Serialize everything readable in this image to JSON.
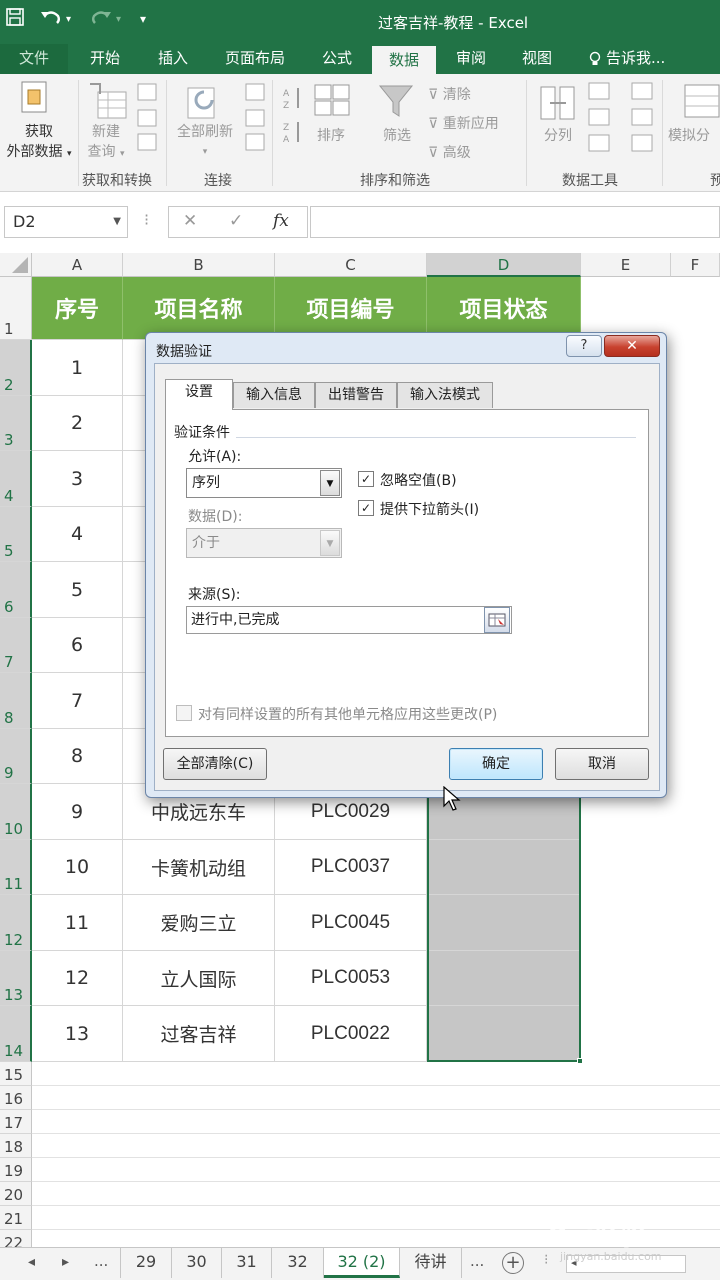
{
  "window": {
    "title": "过客吉祥-教程 - Excel",
    "quick_access": {
      "save_icon": "save-icon",
      "undo_icon": "undo-icon",
      "redo_icon": "redo-icon",
      "customize_icon": "customize-icon"
    }
  },
  "ribbon_tabs": {
    "file": "文件",
    "home": "开始",
    "insert": "插入",
    "page_layout": "页面布局",
    "formulas": "公式",
    "data": "数据",
    "review": "审阅",
    "view": "视图",
    "tell_me": "告诉我..."
  },
  "ribbon": {
    "get_external_data_1": "获取",
    "get_external_data_2": "外部数据",
    "new_query_1": "新建",
    "new_query_2": "查询",
    "group_get_transform": "获取和转换",
    "refresh_all": "全部刷新",
    "group_connections": "连接",
    "sort": "排序",
    "filter": "筛选",
    "clear": "清除",
    "reapply": "重新应用",
    "advanced": "高级",
    "group_sort_filter": "排序和筛选",
    "text_to_columns": "分列",
    "group_data_tools": "数据工具",
    "what_if": "模拟分",
    "group_forecast": "预"
  },
  "formula_bar": {
    "name_box": "D2",
    "cancel_symbol": "✕",
    "enter_symbol": "✓",
    "fx_symbol": "fx",
    "formula": ""
  },
  "grid": {
    "columns": [
      "A",
      "B",
      "C",
      "D",
      "E",
      "F"
    ],
    "header_row": [
      "序号",
      "项目名称",
      "项目编号",
      "项目状态"
    ],
    "rows": [
      {
        "row": "2",
        "a": "1",
        "b": "",
        "c": ""
      },
      {
        "row": "3",
        "a": "2",
        "b": "",
        "c": ""
      },
      {
        "row": "4",
        "a": "3",
        "b": "",
        "c": ""
      },
      {
        "row": "5",
        "a": "4",
        "b": "",
        "c": ""
      },
      {
        "row": "6",
        "a": "5",
        "b": "",
        "c": ""
      },
      {
        "row": "7",
        "a": "6",
        "b": "",
        "c": ""
      },
      {
        "row": "8",
        "a": "7",
        "b": "",
        "c": ""
      },
      {
        "row": "9",
        "a": "8",
        "b": "",
        "c": ""
      },
      {
        "row": "10",
        "a": "9",
        "b": "中成远东车",
        "c": "PLC0029"
      },
      {
        "row": "11",
        "a": "10",
        "b": "卡簧机动组",
        "c": "PLC0037"
      },
      {
        "row": "12",
        "a": "11",
        "b": "爱购三立",
        "c": "PLC0045"
      },
      {
        "row": "13",
        "a": "12",
        "b": "立人国际",
        "c": "PLC0053"
      },
      {
        "row": "14",
        "a": "13",
        "b": "过客吉祥",
        "c": "PLC0022"
      }
    ],
    "empty_rows": [
      "15",
      "16",
      "17",
      "18",
      "19",
      "20",
      "21",
      "22"
    ],
    "colors": {
      "header_fill": "#70ad47",
      "accent": "#217346",
      "selection_fill": "#c6c6c6"
    }
  },
  "sheet_tabs": {
    "prev": "◂",
    "next": "▸",
    "more_left": "...",
    "tabs": [
      "29",
      "30",
      "31",
      "32",
      "32 (2)",
      "待讲"
    ],
    "active": "32 (2)",
    "more_right": "...",
    "add": "+"
  },
  "watermark": {
    "logo": "Bai经验",
    "url": "jingyan.baidu.com"
  },
  "dialog": {
    "title": "数据验证",
    "help": "?",
    "close": "✕",
    "tabs": [
      "设置",
      "输入信息",
      "出错警告",
      "输入法模式"
    ],
    "section_title": "验证条件",
    "allow_label": "允许(A):",
    "allow_value": "序列",
    "data_label": "数据(D):",
    "data_value": "介于",
    "ignore_blank": {
      "label": "忽略空值(B)",
      "checked": true
    },
    "in_cell_dropdown": {
      "label": "提供下拉箭头(I)",
      "checked": true
    },
    "source_label": "来源(S):",
    "source_value": "进行中,已完成",
    "apply_all": {
      "label": "对有同样设置的所有其他单元格应用这些更改(P)",
      "checked": false
    },
    "clear_all": "全部清除(C)",
    "ok": "确定",
    "cancel": "取消"
  }
}
